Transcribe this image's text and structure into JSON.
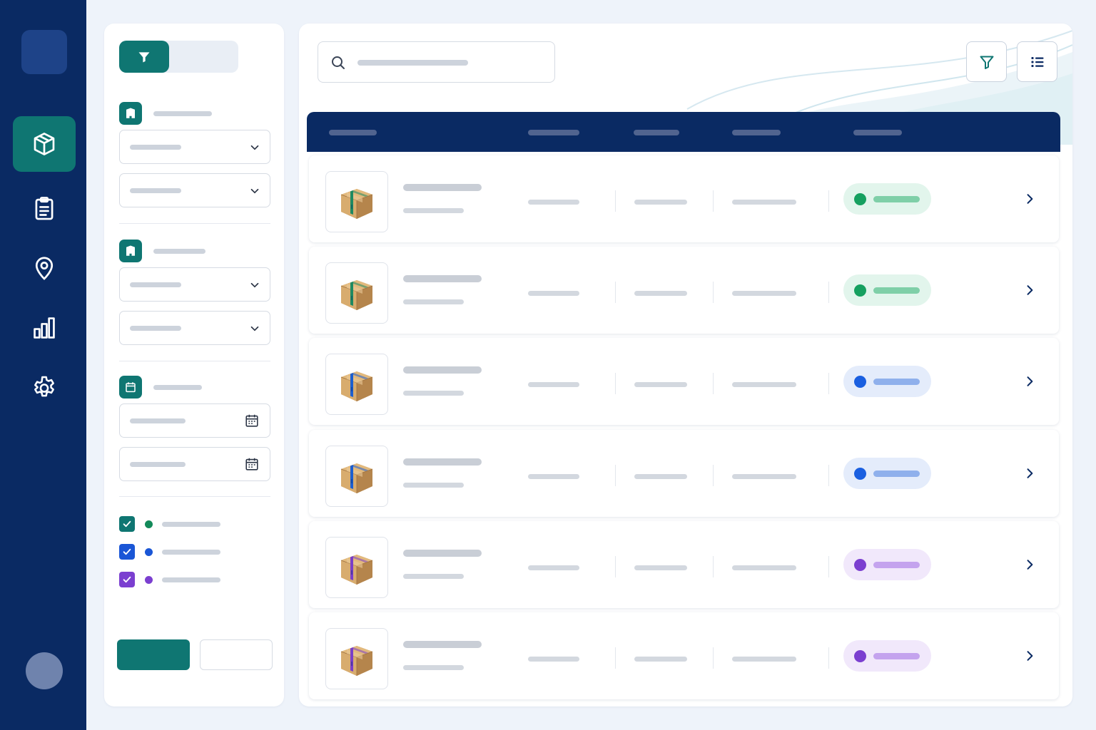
{
  "nav": {
    "items": [
      {
        "name": "inventory",
        "icon": "box-icon",
        "active": true
      },
      {
        "name": "orders",
        "icon": "clipboard-icon",
        "active": false
      },
      {
        "name": "locations",
        "icon": "map-pin-icon",
        "active": false
      },
      {
        "name": "reports",
        "icon": "bar-chart-icon",
        "active": false
      },
      {
        "name": "settings",
        "icon": "gear-icon",
        "active": false
      }
    ]
  },
  "filters": {
    "sections": [
      {
        "icon": "building-icon",
        "fields": [
          "select",
          "select"
        ]
      },
      {
        "icon": "building-icon",
        "fields": [
          "select",
          "select"
        ]
      },
      {
        "icon": "calendar-icon",
        "fields": [
          "date",
          "date"
        ]
      }
    ],
    "status_checks": [
      {
        "checked": true,
        "color": "#138a5a"
      },
      {
        "checked": true,
        "color": "#1a56d6"
      },
      {
        "checked": true,
        "color": "#7b3fd0"
      }
    ]
  },
  "toolbar": {
    "icons": [
      "search-icon",
      "filter-icon",
      "list-icon"
    ]
  },
  "table": {
    "rows": [
      {
        "status": "green",
        "tape": "#1f8a62"
      },
      {
        "status": "green",
        "tape": "#1f8a62"
      },
      {
        "status": "blue",
        "tape": "#1d5fd0"
      },
      {
        "status": "blue",
        "tape": "#1d5fd0"
      },
      {
        "status": "purple",
        "tape": "#7a3fc8"
      },
      {
        "status": "purple",
        "tape": "#7a3fc8"
      }
    ]
  },
  "colors": {
    "accent": "#0f7672",
    "navy": "#0a2a63",
    "status_green_bg": "#e2f5ec",
    "status_green_dot": "#16a060",
    "status_green_line": "#7fcfa8",
    "status_blue_bg": "#e4ecfb",
    "status_blue_dot": "#1a5fe0",
    "status_blue_line": "#8fb0ec",
    "status_purple_bg": "#f1e8fb",
    "status_purple_dot": "#7b3fd0",
    "status_purple_line": "#c4a3ee"
  }
}
